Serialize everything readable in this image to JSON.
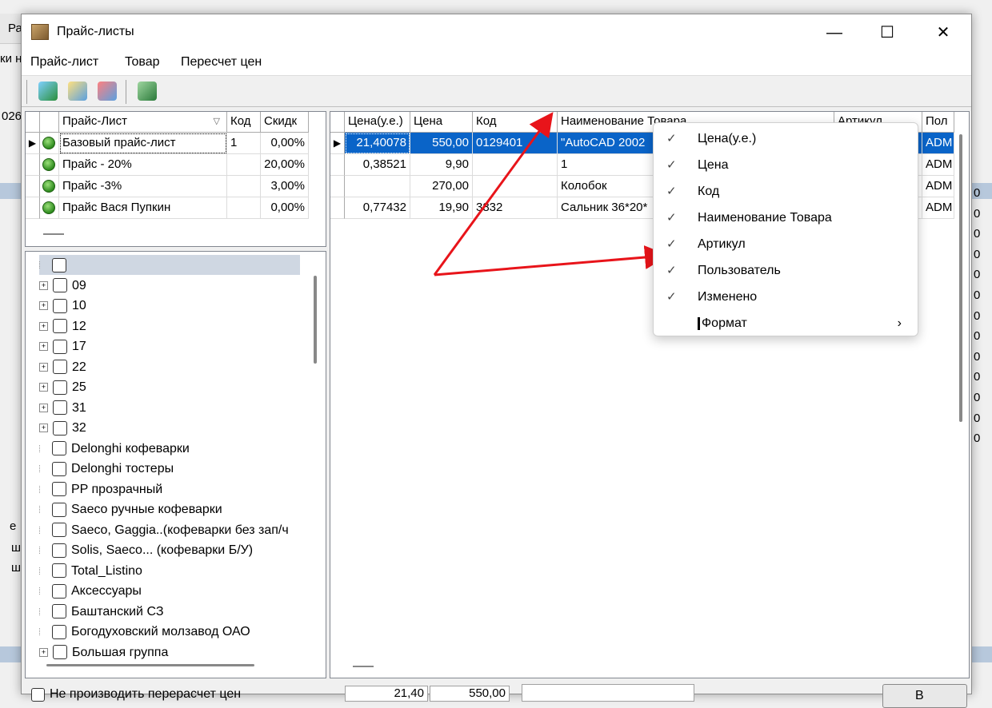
{
  "window": {
    "title": "Прайс-листы",
    "min_glyph": "—",
    "max_glyph": "☐",
    "close_glyph": "✕"
  },
  "menu": [
    "Прайс-лист",
    "Товар",
    "Пересчет цен"
  ],
  "bg_fragments": [
    "Ра",
    "ки н",
    "026",
    "е",
    "ш",
    "ш"
  ],
  "pricelists": {
    "columns": [
      "Прайс-Лист",
      "Код",
      "Скидк"
    ],
    "rows": [
      {
        "name": "Базовый прайс-лист",
        "code": "1",
        "discount": "0,00%",
        "selected": true
      },
      {
        "name": "Прайс - 20%",
        "code": "",
        "discount": "20,00%",
        "selected": false
      },
      {
        "name": "Прайс -3%",
        "code": "",
        "discount": "3,00%",
        "selected": false
      },
      {
        "name": "Прайс Вася Пупкин",
        "code": "",
        "discount": "0,00%",
        "selected": false
      }
    ]
  },
  "groups": [
    {
      "label": "",
      "expandable": false
    },
    {
      "label": "09",
      "expandable": true
    },
    {
      "label": "10",
      "expandable": true
    },
    {
      "label": "12",
      "expandable": true
    },
    {
      "label": "17",
      "expandable": true
    },
    {
      "label": "22",
      "expandable": true
    },
    {
      "label": "25",
      "expandable": true
    },
    {
      "label": "31",
      "expandable": true
    },
    {
      "label": "32",
      "expandable": true
    },
    {
      "label": "Delonghi кофеварки",
      "expandable": false
    },
    {
      "label": "Delonghi тостеры",
      "expandable": false
    },
    {
      "label": "PP прозрачный",
      "expandable": false
    },
    {
      "label": "Saeco   ручные кофеварки",
      "expandable": false
    },
    {
      "label": "Saeco, Gaggia..(кофеварки без зап/ч",
      "expandable": false
    },
    {
      "label": "Solis, Saeco... (кофеварки Б/У)",
      "expandable": false
    },
    {
      "label": "Total_Listino",
      "expandable": false
    },
    {
      "label": "Аксессуары",
      "expandable": false
    },
    {
      "label": "Баштанский СЗ",
      "expandable": false
    },
    {
      "label": "Богодуховский молзавод ОАО",
      "expandable": false
    },
    {
      "label": "Большая группа",
      "expandable": true
    }
  ],
  "goods": {
    "columns": [
      "Цена(у.е.)",
      "Цена",
      "Код",
      "Наименование Товара",
      "Артикул",
      "Пол"
    ],
    "rows": [
      {
        "price_ue": "21,40078",
        "price": "550,00",
        "code": "0129401",
        "name": "\"AutoCAD 2002",
        "user": "ADM",
        "selected": true
      },
      {
        "price_ue": "0,38521",
        "price": "9,90",
        "code": "",
        "name": "1",
        "user": "ADM",
        "selected": false
      },
      {
        "price_ue": "",
        "price": "270,00",
        "code": "",
        "name": "Колобок",
        "user": "ADM",
        "selected": false
      },
      {
        "price_ue": "0,77432",
        "price": "19,90",
        "code": "3832",
        "name": "Сальник 36*20*",
        "user": "ADM",
        "selected": false
      }
    ]
  },
  "context_menu": {
    "items": [
      {
        "label": "Цена(у.е.)",
        "checked": true
      },
      {
        "label": "Цена",
        "checked": true
      },
      {
        "label": "Код",
        "checked": true
      },
      {
        "label": "Наименование Товара",
        "checked": true
      },
      {
        "label": "Артикул",
        "checked": true
      },
      {
        "label": "Пользователь",
        "checked": true
      },
      {
        "label": "Изменено",
        "checked": true
      }
    ],
    "submenu": {
      "label": "Формат",
      "arrow": "›"
    },
    "check_glyph": "✓"
  },
  "right_edge_values": [
    "0",
    "0",
    "0",
    "0",
    "0",
    "0",
    "0",
    "0",
    "0",
    "0",
    "0",
    "0",
    "0"
  ],
  "bottom": {
    "checkbox_label": "Не производить перерасчет цен",
    "price_ue": "21,40",
    "price": "550,00",
    "button_label": "В"
  },
  "colors": {
    "selection": "#0a64c8",
    "arrow": "#e8141a"
  }
}
